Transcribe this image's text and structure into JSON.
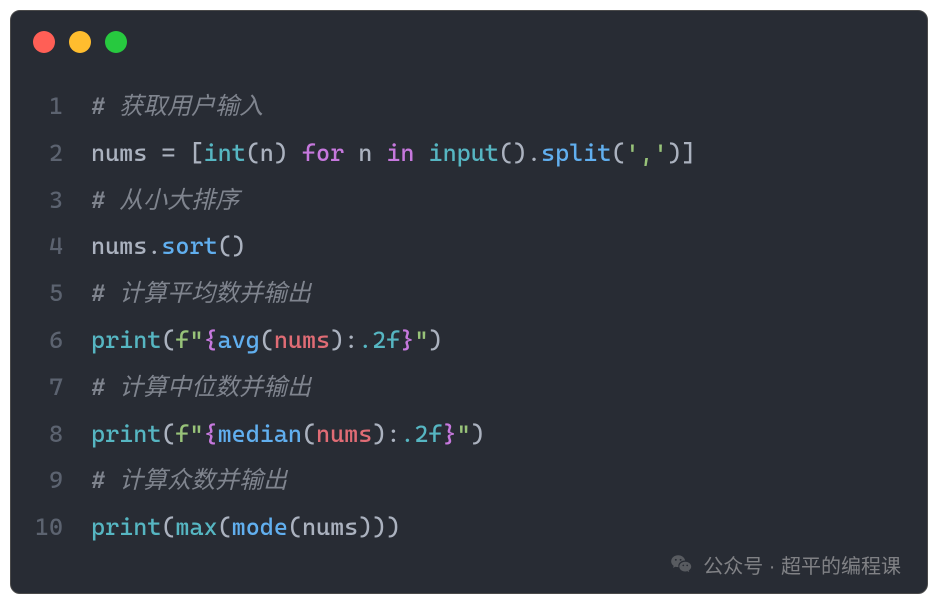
{
  "window": {
    "traffic_lights": [
      "red",
      "yellow",
      "green"
    ]
  },
  "code": {
    "lines": [
      {
        "num": "1",
        "tokens": [
          {
            "t": "# 获取用户输入",
            "c": "comment"
          }
        ]
      },
      {
        "num": "2",
        "tokens": [
          {
            "t": "nums",
            "c": "ident"
          },
          {
            "t": " ",
            "c": "op"
          },
          {
            "t": "=",
            "c": "op"
          },
          {
            "t": " ",
            "c": "op"
          },
          {
            "t": "[",
            "c": "punct"
          },
          {
            "t": "int",
            "c": "builtin"
          },
          {
            "t": "(",
            "c": "punct"
          },
          {
            "t": "n",
            "c": "ident"
          },
          {
            "t": ")",
            "c": "punct"
          },
          {
            "t": " ",
            "c": "op"
          },
          {
            "t": "for",
            "c": "keyword"
          },
          {
            "t": " ",
            "c": "op"
          },
          {
            "t": "n",
            "c": "ident"
          },
          {
            "t": " ",
            "c": "op"
          },
          {
            "t": "in",
            "c": "keyword"
          },
          {
            "t": " ",
            "c": "op"
          },
          {
            "t": "input",
            "c": "builtin"
          },
          {
            "t": "(",
            "c": "punct"
          },
          {
            "t": ")",
            "c": "punct"
          },
          {
            "t": ".",
            "c": "punct"
          },
          {
            "t": "split",
            "c": "call"
          },
          {
            "t": "(",
            "c": "punct"
          },
          {
            "t": "','",
            "c": "string"
          },
          {
            "t": ")",
            "c": "punct"
          },
          {
            "t": "]",
            "c": "punct"
          }
        ]
      },
      {
        "num": "3",
        "tokens": [
          {
            "t": "# 从小大排序",
            "c": "comment"
          }
        ]
      },
      {
        "num": "4",
        "tokens": [
          {
            "t": "nums",
            "c": "ident"
          },
          {
            "t": ".",
            "c": "punct"
          },
          {
            "t": "sort",
            "c": "call"
          },
          {
            "t": "(",
            "c": "punct"
          },
          {
            "t": ")",
            "c": "punct"
          }
        ]
      },
      {
        "num": "5",
        "tokens": [
          {
            "t": "# 计算平均数并输出",
            "c": "comment"
          }
        ]
      },
      {
        "num": "6",
        "tokens": [
          {
            "t": "print",
            "c": "builtin"
          },
          {
            "t": "(",
            "c": "punct"
          },
          {
            "t": "f\"",
            "c": "string"
          },
          {
            "t": "{",
            "c": "fstr-brace"
          },
          {
            "t": "avg",
            "c": "fstr-func"
          },
          {
            "t": "(",
            "c": "punct"
          },
          {
            "t": "nums",
            "c": "fstr-expr"
          },
          {
            "t": ")",
            "c": "punct"
          },
          {
            "t": ":",
            "c": "punct"
          },
          {
            "t": ".2f",
            "c": "fstr-format"
          },
          {
            "t": "}",
            "c": "fstr-brace"
          },
          {
            "t": "\"",
            "c": "string"
          },
          {
            "t": ")",
            "c": "punct"
          }
        ]
      },
      {
        "num": "7",
        "tokens": [
          {
            "t": "# 计算中位数并输出",
            "c": "comment"
          }
        ]
      },
      {
        "num": "8",
        "tokens": [
          {
            "t": "print",
            "c": "builtin"
          },
          {
            "t": "(",
            "c": "punct"
          },
          {
            "t": "f\"",
            "c": "string"
          },
          {
            "t": "{",
            "c": "fstr-brace"
          },
          {
            "t": "median",
            "c": "fstr-func"
          },
          {
            "t": "(",
            "c": "punct"
          },
          {
            "t": "nums",
            "c": "fstr-expr"
          },
          {
            "t": ")",
            "c": "punct"
          },
          {
            "t": ":",
            "c": "punct"
          },
          {
            "t": ".2f",
            "c": "fstr-format"
          },
          {
            "t": "}",
            "c": "fstr-brace"
          },
          {
            "t": "\"",
            "c": "string"
          },
          {
            "t": ")",
            "c": "punct"
          }
        ]
      },
      {
        "num": "9",
        "tokens": [
          {
            "t": "# 计算众数并输出",
            "c": "comment"
          }
        ]
      },
      {
        "num": "10",
        "tokens": [
          {
            "t": "print",
            "c": "builtin"
          },
          {
            "t": "(",
            "c": "punct"
          },
          {
            "t": "max",
            "c": "builtin"
          },
          {
            "t": "(",
            "c": "punct"
          },
          {
            "t": "mode",
            "c": "call"
          },
          {
            "t": "(",
            "c": "punct"
          },
          {
            "t": "nums",
            "c": "ident"
          },
          {
            "t": ")",
            "c": "punct"
          },
          {
            "t": ")",
            "c": "punct"
          },
          {
            "t": ")",
            "c": "punct"
          }
        ]
      }
    ]
  },
  "watermark": {
    "text": "公众号 · 超平的编程课"
  }
}
